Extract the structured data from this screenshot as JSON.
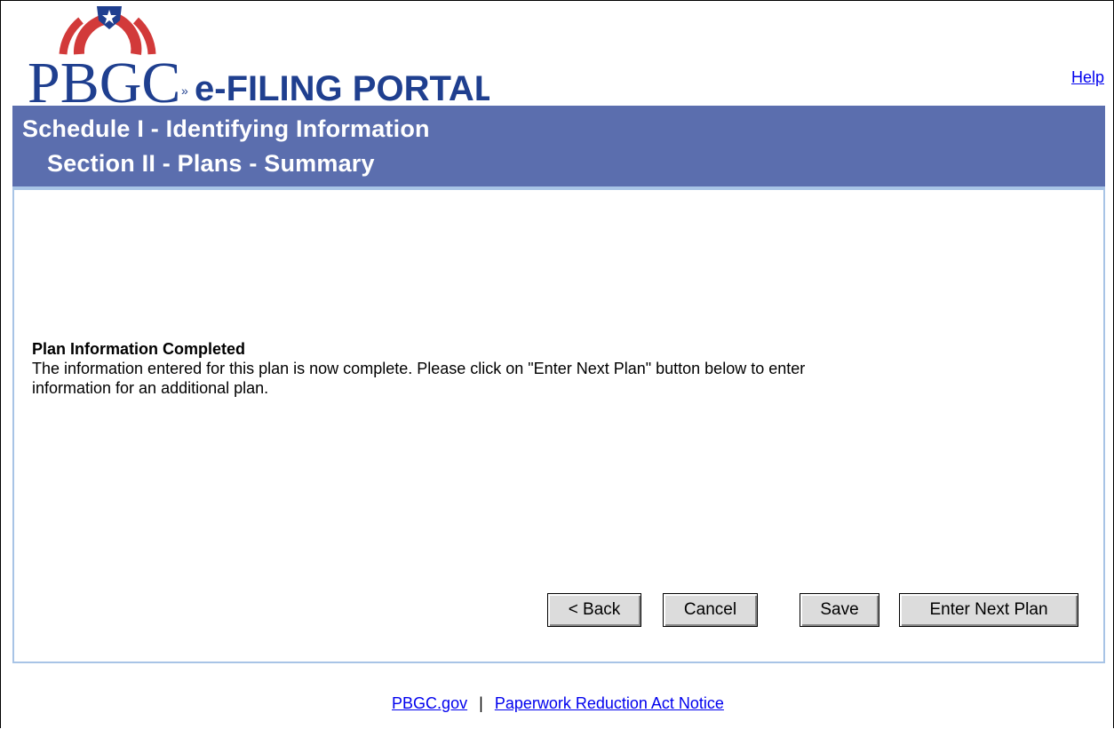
{
  "header": {
    "logo_text": "PBGC",
    "logo_subtitle": "e-FILING PORTAL",
    "help_link": "Help",
    "colors": {
      "logo_red": "#d23a3a",
      "logo_blue": "#1f3f8f",
      "title_bar": "#5b6eae"
    }
  },
  "title": {
    "line1": "Schedule I - Identifying Information",
    "line2": "Section II - Plans - Summary"
  },
  "message": {
    "heading": "Plan Information Completed",
    "body": "The information entered for this plan is now complete. Please click on \"Enter Next Plan\" button below to enter information for an additional plan."
  },
  "buttons": {
    "back": "< Back",
    "cancel": "Cancel",
    "save": "Save",
    "enter_next": "Enter Next Plan"
  },
  "footer": {
    "link1": "PBGC.gov",
    "separator": "|",
    "link2": "Paperwork Reduction Act Notice"
  }
}
